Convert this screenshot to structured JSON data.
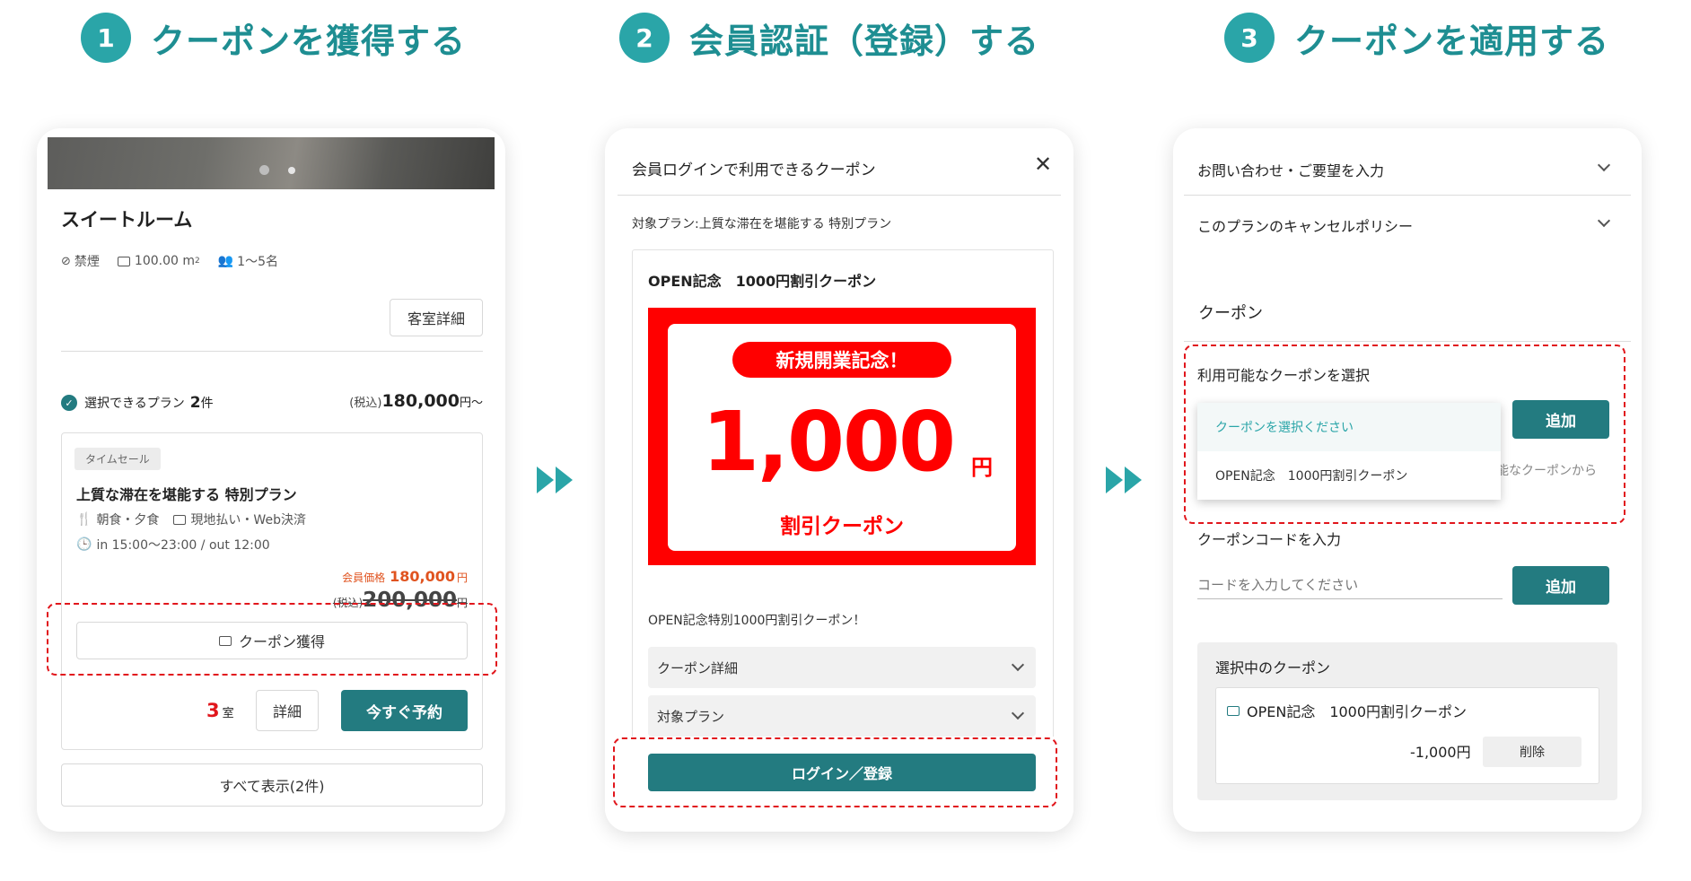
{
  "steps": [
    {
      "num": "1",
      "title": "クーポンを獲得する"
    },
    {
      "num": "2",
      "title": "会員認証（登録）する"
    },
    {
      "num": "3",
      "title": "クーポンを適用する"
    }
  ],
  "colors": {
    "teal_accent": "#2aa5a8",
    "teal_button": "#237b80",
    "highlight_red": "#e1161c",
    "coupon_red": "#ff0000",
    "price_orange": "#e0531f"
  },
  "panel1": {
    "room_name": "スイートルーム",
    "no_smoking": "禁煙",
    "area": "100.00 m",
    "area_sup": "2",
    "capacity": "1〜5名",
    "room_detail_button": "客室詳細",
    "plans_label": "選択できるプラン",
    "plans_count": "2",
    "plans_unit": "件",
    "tax_prefix": "(税込)",
    "from_price": "180,000",
    "from_suffix": "円〜",
    "plan": {
      "tag": "タイムセール",
      "name": "上質な滞在を堪能する 特別プラン",
      "meals": "朝食・夕食",
      "payment": "現地払い・Web決済",
      "checkin": "in 15:00〜23:00 / out 12:00",
      "member_label": "会員価格",
      "member_price": "180,000",
      "yen": "円",
      "tax_label": "(税込)",
      "regular_price": "200,000",
      "coupon_button": "クーポン獲得",
      "rooms_left": "3",
      "rooms_unit": "室",
      "detail_button": "詳細",
      "reserve_button": "今すぐ予約"
    },
    "show_all": "すべて表示(2件)"
  },
  "panel2": {
    "title": "会員ログインで利用できるクーポン",
    "target_plan": "対象プラン:上質な滞在を堪能する 特別プラン",
    "coupon_name": "OPEN記念　1000円割引クーポン",
    "banner_pill": "新規開業記念！",
    "banner_amount": "1,000",
    "banner_yen": "円",
    "banner_sub": "割引クーポン",
    "description": "OPEN記念特別1000円割引クーポン！",
    "accordion_detail": "クーポン詳細",
    "accordion_plan": "対象プラン",
    "login_button": "ログイン／登録"
  },
  "panel3": {
    "inquiry": "お問い合わせ・ご要望を入力",
    "cancel_policy": "このプランのキャンセルポリシー",
    "coupon_heading": "クーポン",
    "select_label": "利用可能なクーポンを選択",
    "dropdown_options": [
      "クーポンを選択ください",
      "OPEN記念　1000円割引クーポン"
    ],
    "add_button": "追加",
    "hidden_text": "能なクーポンから",
    "code_label": "クーポンコードを入力",
    "code_placeholder": "コードを入力してください",
    "selected_heading": "選択中のクーポン",
    "selected_name": "OPEN記念　1000円割引クーポン",
    "selected_discount": "-1,000円",
    "delete_button": "削除"
  }
}
